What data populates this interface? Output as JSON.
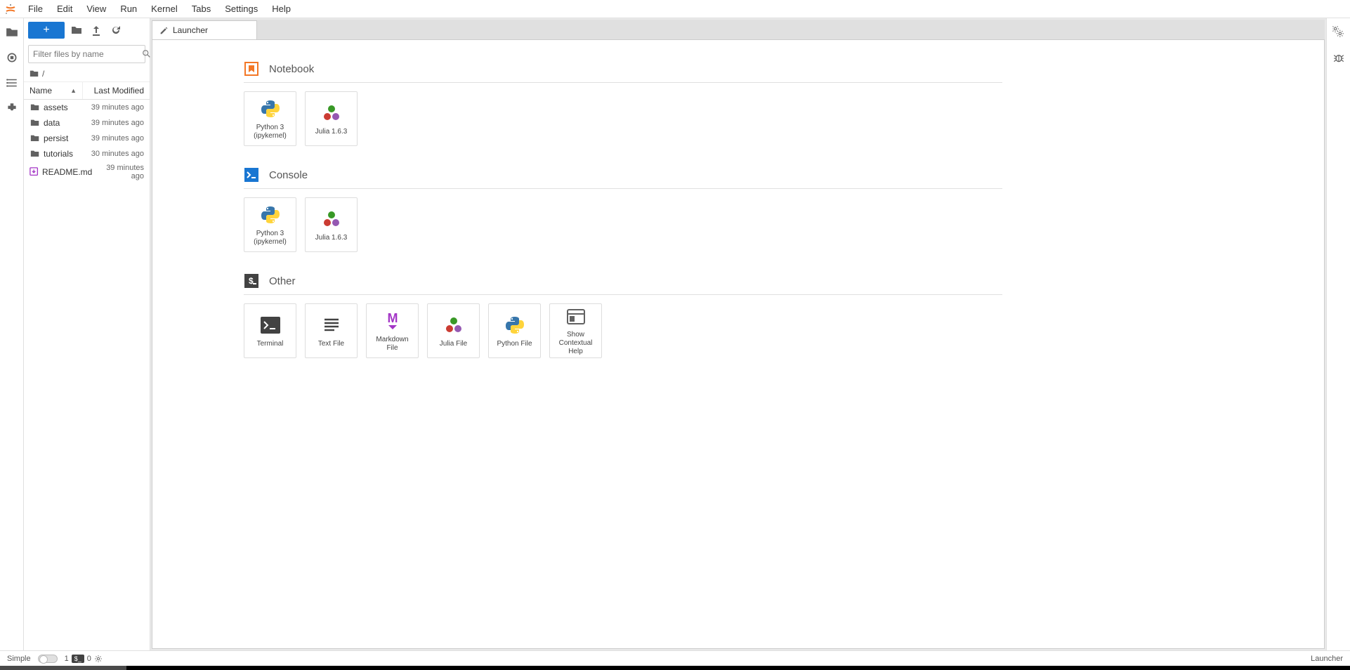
{
  "menubar": [
    "File",
    "Edit",
    "View",
    "Run",
    "Kernel",
    "Tabs",
    "Settings",
    "Help"
  ],
  "filepanel": {
    "filter_placeholder": "Filter files by name",
    "breadcrumb_root": "/",
    "columns": {
      "name": "Name",
      "modified": "Last Modified"
    },
    "items": [
      {
        "type": "folder",
        "name": "assets",
        "modified": "39 minutes ago"
      },
      {
        "type": "folder",
        "name": "data",
        "modified": "39 minutes ago"
      },
      {
        "type": "folder",
        "name": "persist",
        "modified": "39 minutes ago"
      },
      {
        "type": "folder",
        "name": "tutorials",
        "modified": "30 minutes ago"
      },
      {
        "type": "markdown",
        "name": "README.md",
        "modified": "39 minutes ago"
      }
    ]
  },
  "tab": {
    "title": "Launcher"
  },
  "launcher": {
    "sections": [
      {
        "id": "notebook",
        "label": "Notebook",
        "icon": "notebook-icon",
        "cards": [
          {
            "id": "py3-nb",
            "label": "Python 3 (ipykernel)",
            "icon": "python-icon"
          },
          {
            "id": "julia-nb",
            "label": "Julia 1.6.3",
            "icon": "julia-icon"
          }
        ]
      },
      {
        "id": "console",
        "label": "Console",
        "icon": "console-icon",
        "cards": [
          {
            "id": "py3-con",
            "label": "Python 3 (ipykernel)",
            "icon": "python-icon"
          },
          {
            "id": "julia-con",
            "label": "Julia 1.6.3",
            "icon": "julia-icon"
          }
        ]
      },
      {
        "id": "other",
        "label": "Other",
        "icon": "terminal-icon",
        "cards": [
          {
            "id": "terminal",
            "label": "Terminal",
            "icon": "terminal-icon"
          },
          {
            "id": "textfile",
            "label": "Text File",
            "icon": "textfile-icon"
          },
          {
            "id": "mdfile",
            "label": "Markdown File",
            "icon": "markdown-icon"
          },
          {
            "id": "juliafile",
            "label": "Julia File",
            "icon": "julia-icon"
          },
          {
            "id": "pyfile",
            "label": "Python File",
            "icon": "python-icon"
          },
          {
            "id": "ctxhelp",
            "label": "Show Contextual Help",
            "icon": "help-panel-icon"
          }
        ]
      }
    ]
  },
  "statusbar": {
    "simple_label": "Simple",
    "terminals": "1",
    "kernels": "0",
    "right": "Launcher"
  }
}
